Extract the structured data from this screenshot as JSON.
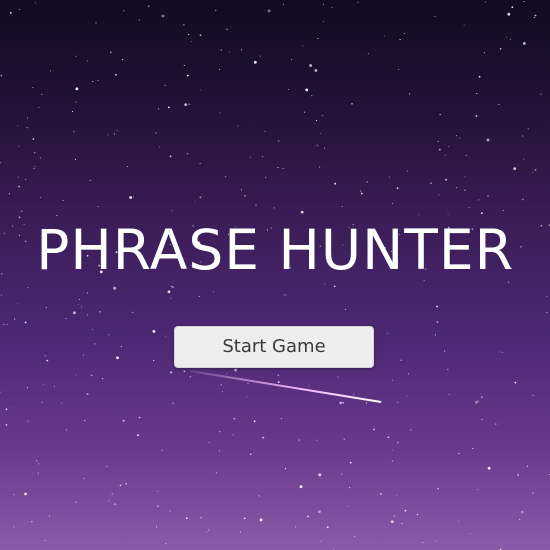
{
  "overlay": {
    "title": "PHRASE HUNTER",
    "start_button_label": "Start Game"
  },
  "colors": {
    "sky_top": "#130a22",
    "sky_bottom": "#8b5aa8",
    "title_text": "#ffffff",
    "button_bg": "#eeeeee",
    "button_text": "#3a3a3a"
  }
}
